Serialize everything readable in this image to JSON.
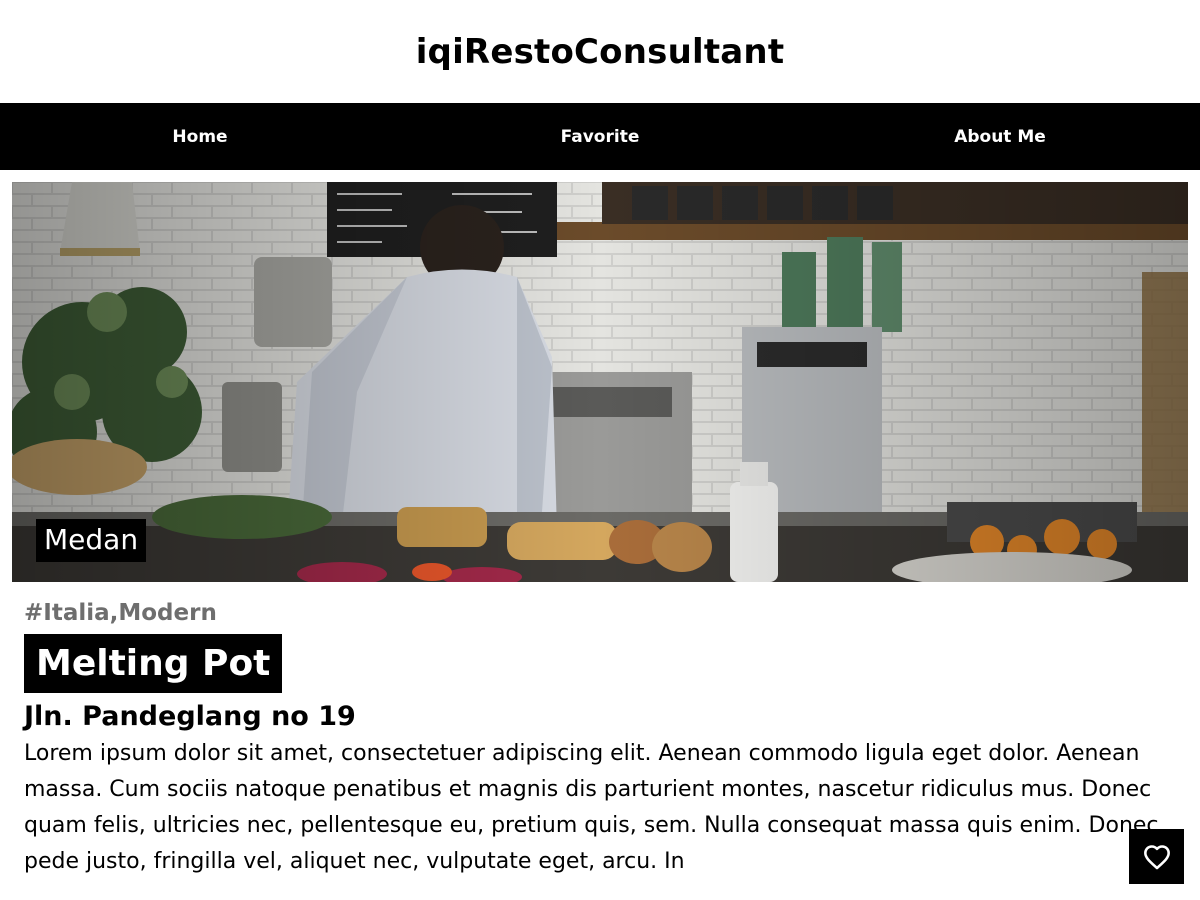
{
  "header": {
    "title": "iqiRestoConsultant"
  },
  "nav": {
    "items": [
      {
        "label": "Home"
      },
      {
        "label": "Favorite"
      },
      {
        "label": "About Me"
      }
    ]
  },
  "restaurant": {
    "city": "Medan",
    "tags": "#Italia,Modern",
    "name": "Melting Pot",
    "address": "Jln. Pandeglang no 19",
    "description": "Lorem ipsum dolor sit amet, consectetuer adipiscing elit. Aenean commodo ligula eget dolor. Aenean massa. Cum sociis natoque penatibus et magnis dis parturient montes, nascetur ridiculus mus. Donec quam felis, ultricies nec, pellentesque eu, pretium quis, sem. Nulla consequat massa quis enim. Donec pede justo, fringilla vel, aliquet nec, vulputate eget, arcu. In"
  },
  "favorite_button": {
    "icon": "heart-outline-icon"
  },
  "colors": {
    "nav_bg": "#000000",
    "nav_text": "#ffffff",
    "tag_text": "#6e6e6e"
  }
}
